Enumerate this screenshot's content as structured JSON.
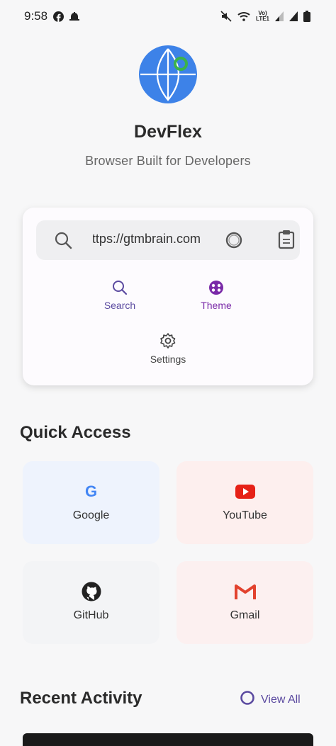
{
  "status_bar": {
    "time": "9:58",
    "lte": "Vo)\nLTE1",
    "icons": [
      "facebook-icon",
      "notification-icon",
      "mute-icon",
      "wifi-icon",
      "signal-icon",
      "signal-icon",
      "battery-icon"
    ]
  },
  "app": {
    "name": "DevFlex",
    "tagline": "Browser Built for Developers",
    "logo_colors": {
      "primary": "#3d82e8",
      "accent": "#3bb34a"
    }
  },
  "browser_card": {
    "url_value": "https://gtmbrain.com",
    "actions": [
      {
        "label": "Search",
        "icon": "search-icon",
        "color": "#5b4aa0"
      },
      {
        "label": "Theme",
        "icon": "palette-icon",
        "color": "#7a2aa8"
      },
      {
        "label": "Settings",
        "icon": "gear-icon",
        "color": "#444444"
      }
    ]
  },
  "quick_access": {
    "title": "Quick Access",
    "tiles": [
      {
        "label": "Google",
        "icon": "google-icon",
        "bg": "#eef3fd"
      },
      {
        "label": "YouTube",
        "icon": "youtube-icon",
        "bg": "#fdefee"
      },
      {
        "label": "GitHub",
        "icon": "github-icon",
        "bg": "#f3f4f6"
      },
      {
        "label": "Gmail",
        "icon": "gmail-icon",
        "bg": "#fcf0f0"
      }
    ]
  },
  "recent_activity": {
    "title": "Recent Activity",
    "view_all_label": "View All",
    "accent": "#5b4aa0"
  }
}
